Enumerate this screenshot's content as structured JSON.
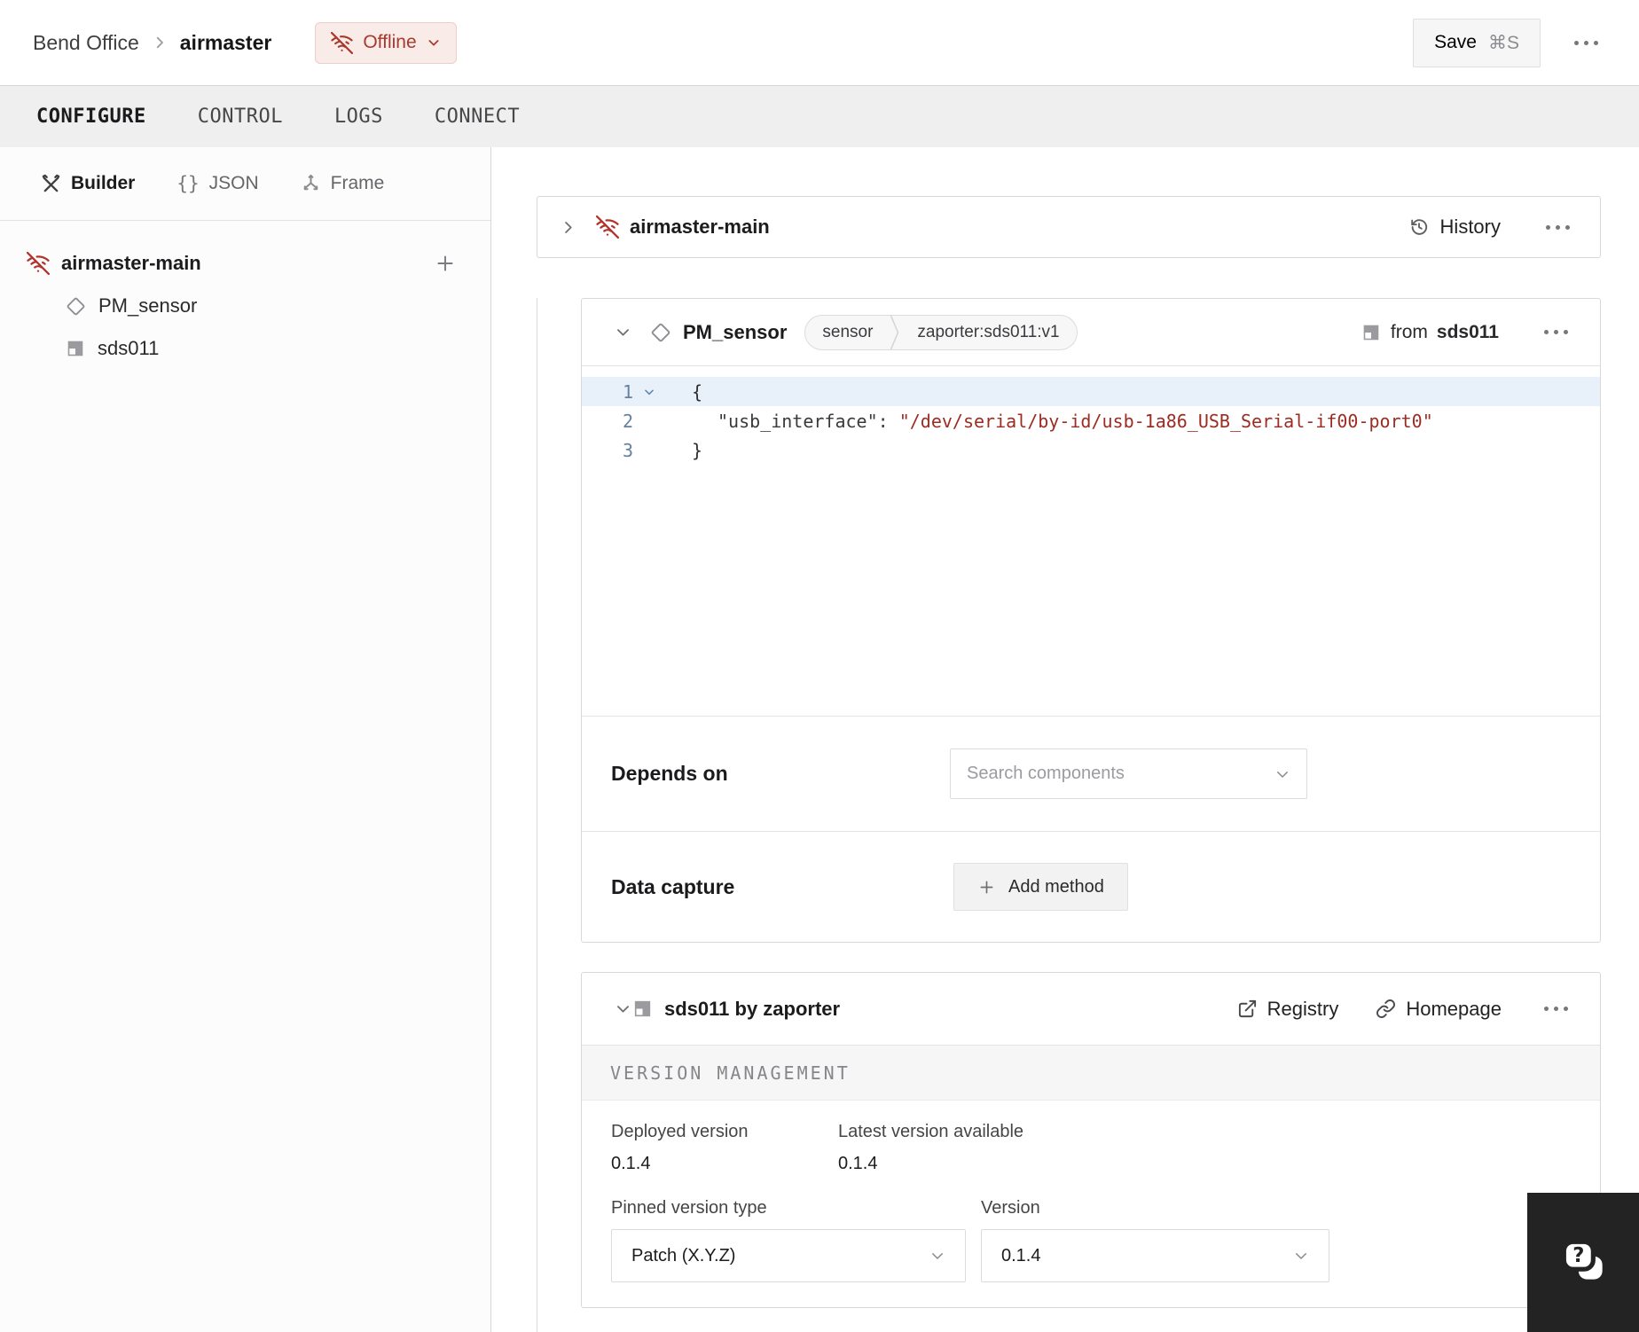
{
  "header": {
    "breadcrumb": {
      "org": "Bend Office",
      "machine": "airmaster"
    },
    "status_badge": {
      "label": "Offline"
    },
    "save_button": {
      "label": "Save",
      "shortcut": "⌘S"
    }
  },
  "tabs": [
    {
      "label": "CONFIGURE"
    },
    {
      "label": "CONTROL"
    },
    {
      "label": "LOGS"
    },
    {
      "label": "CONNECT"
    }
  ],
  "sidebar": {
    "modes": [
      {
        "label": "Builder",
        "icon": "tools-icon"
      },
      {
        "label": "JSON",
        "icon": "braces-icon",
        "glyph": "{}"
      },
      {
        "label": "Frame",
        "icon": "frame-icon"
      }
    ],
    "tree": {
      "root": "airmaster-main",
      "children": [
        "PM_sensor",
        "sds011"
      ]
    }
  },
  "part_card": {
    "title": "airmaster-main",
    "history": "History"
  },
  "sensor_card": {
    "title": "PM_sensor",
    "tag_type": "sensor",
    "tag_model": "zaporter:sds011:v1",
    "from_prefix": "from",
    "from_module": "sds011",
    "code": {
      "n1": "1",
      "n2": "2",
      "n3": "3",
      "l1": "{",
      "l2_key": "\"usb_interface\":",
      "l2_value": "\"/dev/serial/by-id/usb-1a86_USB_Serial-if00-port0\"",
      "l3": "}"
    },
    "depends_on": {
      "label": "Depends on",
      "placeholder": "Search components"
    },
    "data_capture": {
      "label": "Data capture",
      "add_button": "Add method"
    }
  },
  "module_card": {
    "title": "sds011 by zaporter",
    "registry": "Registry",
    "homepage": "Homepage",
    "section": "VERSION MANAGEMENT",
    "deployed_label": "Deployed version",
    "deployed_value": "0.1.4",
    "latest_label": "Latest version available",
    "latest_value": "0.1.4",
    "pinned_label": "Pinned version type",
    "pinned_value": "Patch (X.Y.Z)",
    "version_label": "Version",
    "version_value": "0.1.4"
  },
  "colors": {
    "accent_red": "#a8392d",
    "badge_bg": "#f9ebe8",
    "code_string": "#9e2b22",
    "line_highlight": "#e8f1fa"
  }
}
